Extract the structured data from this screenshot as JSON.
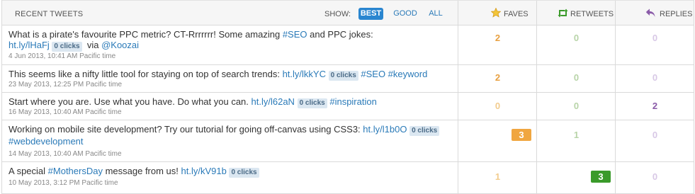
{
  "header": {
    "title": "RECENT TWEETS",
    "show_label": "SHOW:",
    "filters": [
      "BEST",
      "GOOD",
      "ALL"
    ],
    "columns": {
      "faves": "FAVES",
      "retweets": "RETWEETS",
      "replies": "REPLIES"
    }
  },
  "tweets": [
    {
      "line1_text": "What is a pirate's favourite PPC metric? CT-Rrrrrrr! Some amazing ",
      "line1_tag": "#SEO",
      "line1_tail": " and PPC jokes:",
      "link": "ht.ly/lHaFj",
      "clicks": "0 clicks",
      "via": "via",
      "mention": "@Koozai",
      "time": "4 Jun 2013, 10:41 AM Pacific time",
      "faves": "2",
      "retweets": "0",
      "replies": "0"
    },
    {
      "text": "This seems like a nifty little tool for staying on top of search trends: ",
      "link": "ht.ly/lkkYC",
      "clicks": "0 clicks",
      "tags": "#SEO #keyword",
      "time": "23 May 2013, 12:25 PM Pacific time",
      "faves": "2",
      "retweets": "0",
      "replies": "0"
    },
    {
      "text": "Start where you are. Use what you have. Do what you can. ",
      "link": "ht.ly/l62aN",
      "clicks": "0 clicks",
      "tags": "#inspiration",
      "time": "16 May 2013, 10:40 AM Pacific time",
      "faves": "0",
      "retweets": "0",
      "replies": "2"
    },
    {
      "text": "Working on mobile site development? Try our tutorial for going off-canvas using CSS3: ",
      "link": "ht.ly/l1b0O",
      "clicks": "0 clicks",
      "tags": "#webdevelopment",
      "time": "14 May 2013, 10:40 AM Pacific time",
      "faves": "3",
      "retweets": "1",
      "replies": "0"
    },
    {
      "text": "A special ",
      "tag_inline": "#MothersDay",
      "text2": " message from us! ",
      "link": "ht.ly/kV91b",
      "clicks": "0 clicks",
      "time": "10 May 2013, 3:12 PM Pacific time",
      "faves": "1",
      "retweets": "3",
      "replies": "0"
    }
  ],
  "colors": {
    "accent": "#2a86d0",
    "link": "#2a7ab8",
    "faves_strong": "#e8a040",
    "faves_light": "#f2cc8e",
    "retweet_light": "#b8d4a8",
    "retweet_box": "#3a9a2a",
    "replies_light": "#d8c8e6",
    "replies_strong": "#8a5aa8"
  },
  "icons": [
    "star-icon",
    "retweet-icon",
    "reply-icon"
  ]
}
